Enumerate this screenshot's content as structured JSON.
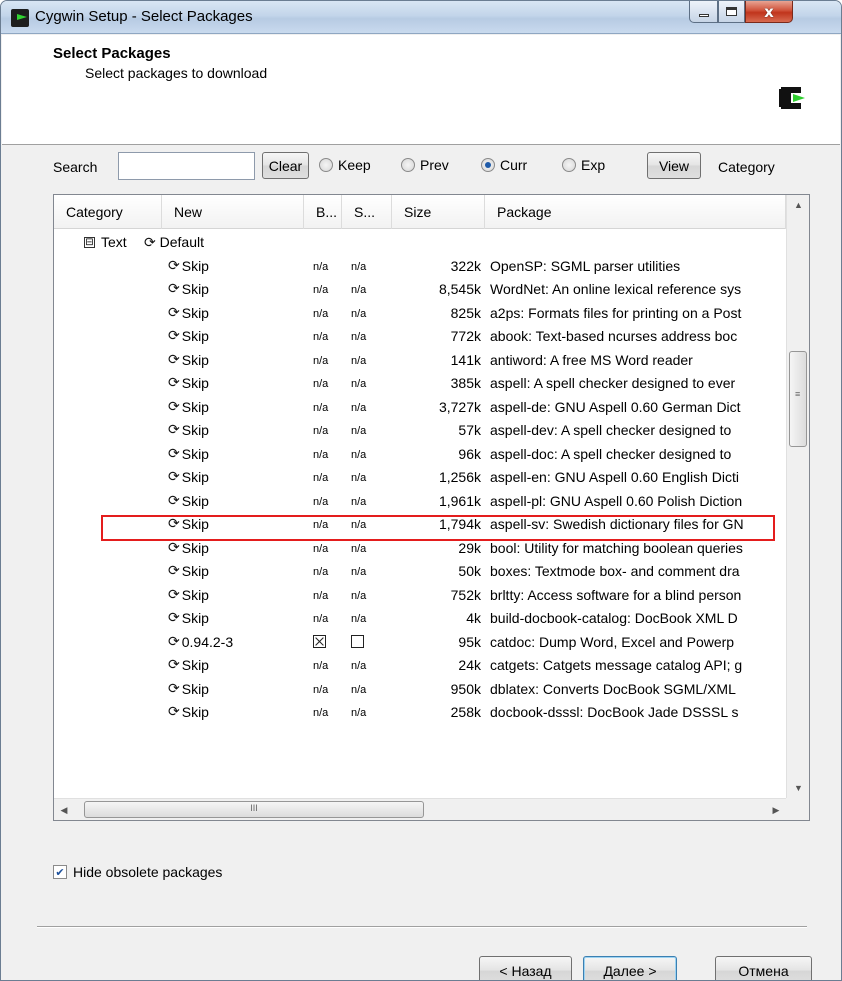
{
  "window": {
    "title": "Cygwin Setup - Select Packages",
    "close_glyph": "x"
  },
  "header": {
    "title": "Select Packages",
    "subtitle": "Select packages to download"
  },
  "toolbar": {
    "search_label": "Search",
    "search_value": "",
    "clear_label": "Clear",
    "radios": [
      {
        "label": "Keep",
        "selected": false
      },
      {
        "label": "Prev",
        "selected": false
      },
      {
        "label": "Curr",
        "selected": true
      },
      {
        "label": "Exp",
        "selected": false
      }
    ],
    "view_label": "View",
    "view_mode": "Category"
  },
  "table": {
    "columns": [
      "Category",
      "New",
      "B...",
      "S...",
      "Size",
      "Package"
    ],
    "category_row": {
      "toggle": "⊟",
      "name": "Text",
      "action": "Default"
    },
    "rows": [
      {
        "new": "Skip",
        "b": "n/a",
        "s": "n/a",
        "size": "322k",
        "package": "OpenSP: SGML parser utilities"
      },
      {
        "new": "Skip",
        "b": "n/a",
        "s": "n/a",
        "size": "8,545k",
        "package": "WordNet: An online lexical reference sys"
      },
      {
        "new": "Skip",
        "b": "n/a",
        "s": "n/a",
        "size": "825k",
        "package": "a2ps: Formats files for printing on a Post"
      },
      {
        "new": "Skip",
        "b": "n/a",
        "s": "n/a",
        "size": "772k",
        "package": "abook: Text-based ncurses address boc"
      },
      {
        "new": "Skip",
        "b": "n/a",
        "s": "n/a",
        "size": "141k",
        "package": "antiword: A free MS Word reader"
      },
      {
        "new": "Skip",
        "b": "n/a",
        "s": "n/a",
        "size": "385k",
        "package": "aspell: A spell checker designed to ever"
      },
      {
        "new": "Skip",
        "b": "n/a",
        "s": "n/a",
        "size": "3,727k",
        "package": "aspell-de: GNU Aspell 0.60 German Dict"
      },
      {
        "new": "Skip",
        "b": "n/a",
        "s": "n/a",
        "size": "57k",
        "package": "aspell-dev: A spell checker designed to"
      },
      {
        "new": "Skip",
        "b": "n/a",
        "s": "n/a",
        "size": "96k",
        "package": "aspell-doc: A spell checker designed to"
      },
      {
        "new": "Skip",
        "b": "n/a",
        "s": "n/a",
        "size": "1,256k",
        "package": "aspell-en: GNU Aspell 0.60 English Dicti"
      },
      {
        "new": "Skip",
        "b": "n/a",
        "s": "n/a",
        "size": "1,961k",
        "package": "aspell-pl: GNU Aspell 0.60 Polish Diction"
      },
      {
        "new": "Skip",
        "b": "n/a",
        "s": "n/a",
        "size": "1,794k",
        "package": "aspell-sv: Swedish dictionary files for GN"
      },
      {
        "new": "Skip",
        "b": "n/a",
        "s": "n/a",
        "size": "29k",
        "package": "bool: Utility for matching boolean queries"
      },
      {
        "new": "Skip",
        "b": "n/a",
        "s": "n/a",
        "size": "50k",
        "package": "boxes: Textmode box- and comment dra"
      },
      {
        "new": "Skip",
        "b": "n/a",
        "s": "n/a",
        "size": "752k",
        "package": "brltty: Access software for a blind person"
      },
      {
        "new": "Skip",
        "b": "n/a",
        "s": "n/a",
        "size": "4k",
        "package": "build-docbook-catalog: DocBook XML D"
      },
      {
        "new": "0.94.2-3",
        "b": "☒",
        "s": "☐",
        "size": "95k",
        "package": "catdoc: Dump Word, Excel and Powerp",
        "highlighted": true
      },
      {
        "new": "Skip",
        "b": "n/a",
        "s": "n/a",
        "size": "24k",
        "package": "catgets: Catgets message catalog API; g"
      },
      {
        "new": "Skip",
        "b": "n/a",
        "s": "n/a",
        "size": "950k",
        "package": "dblatex: Converts DocBook SGML/XML"
      },
      {
        "new": "Skip",
        "b": "n/a",
        "s": "n/a",
        "size": "258k",
        "package": "docbook-dsssl: DocBook Jade DSSSL s"
      }
    ]
  },
  "scroll": {
    "hgrip": "III",
    "vgrip": "≡"
  },
  "options": {
    "hide_obsolete_label": "Hide obsolete packages",
    "hide_obsolete_checked": true
  },
  "footer": {
    "back_label": "< Назад",
    "next_label": "Далее >",
    "cancel_label": "Отмена"
  },
  "colors": {
    "highlight": "#e41d1d",
    "accent": "#3c7fb1"
  }
}
